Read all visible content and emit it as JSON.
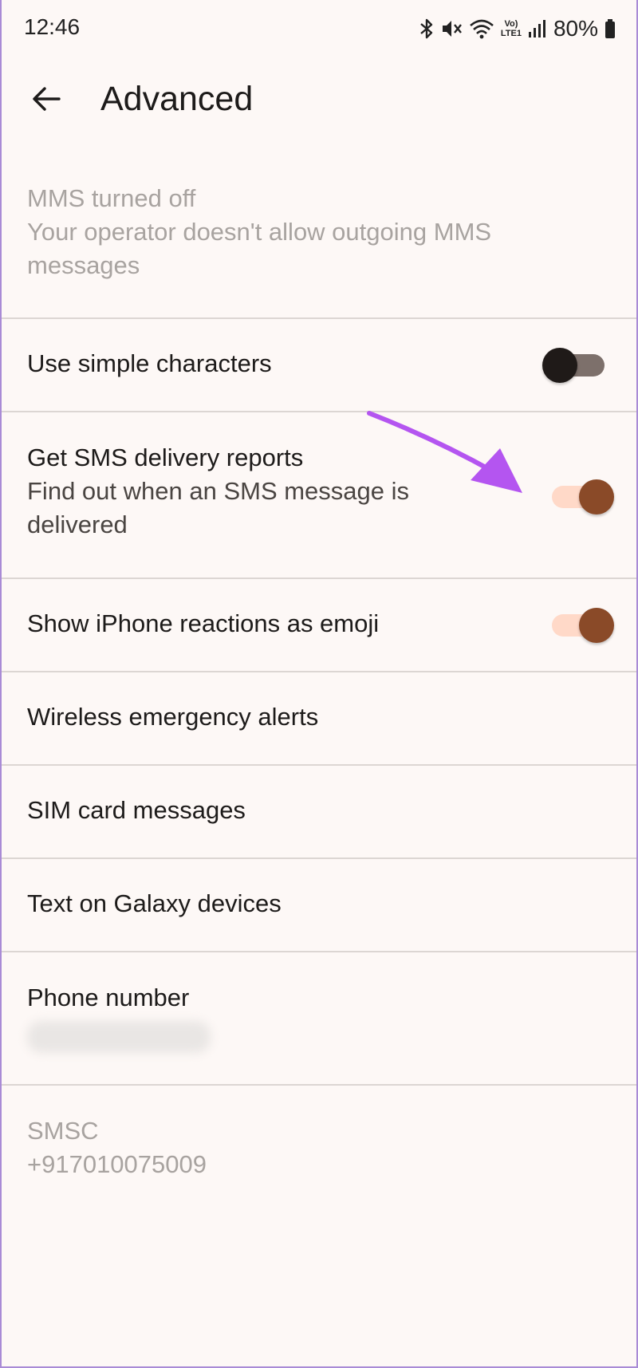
{
  "status_bar": {
    "time": "12:46",
    "icons": [
      "bluetooth-icon",
      "mute-icon",
      "wifi-icon",
      "volte-icon",
      "signal-icon",
      "battery-icon"
    ],
    "lte_label": "LTE1",
    "volte_label": "Vo)",
    "battery": "80%"
  },
  "app_bar": {
    "back_icon": "arrow-back-icon",
    "title": "Advanced"
  },
  "settings": {
    "mms": {
      "title": "MMS turned off",
      "subtitle": "Your operator doesn't allow outgoing MMS messages",
      "enabled": false
    },
    "simple_chars": {
      "title": "Use simple characters",
      "switch_on": false
    },
    "delivery_reports": {
      "title": "Get SMS delivery reports",
      "subtitle": "Find out when an SMS message is delivered",
      "switch_on": true
    },
    "iphone_reactions": {
      "title": "Show iPhone reactions as emoji",
      "switch_on": true
    },
    "emergency_alerts": {
      "title": "Wireless emergency alerts"
    },
    "sim_messages": {
      "title": "SIM card messages"
    },
    "galaxy_text": {
      "title": "Text on Galaxy devices"
    },
    "phone_number": {
      "title": "Phone number"
    },
    "smsc": {
      "title": "SMSC",
      "value": "+917010075009",
      "enabled": false
    }
  },
  "colors": {
    "background": "#fdf8f6",
    "switch_on_knob": "#8a4a28",
    "switch_on_track": "#ffd9c8",
    "switch_off_knob": "#1f1a18",
    "switch_off_track": "#7d706b",
    "annotation_arrow": "#b455f0"
  }
}
